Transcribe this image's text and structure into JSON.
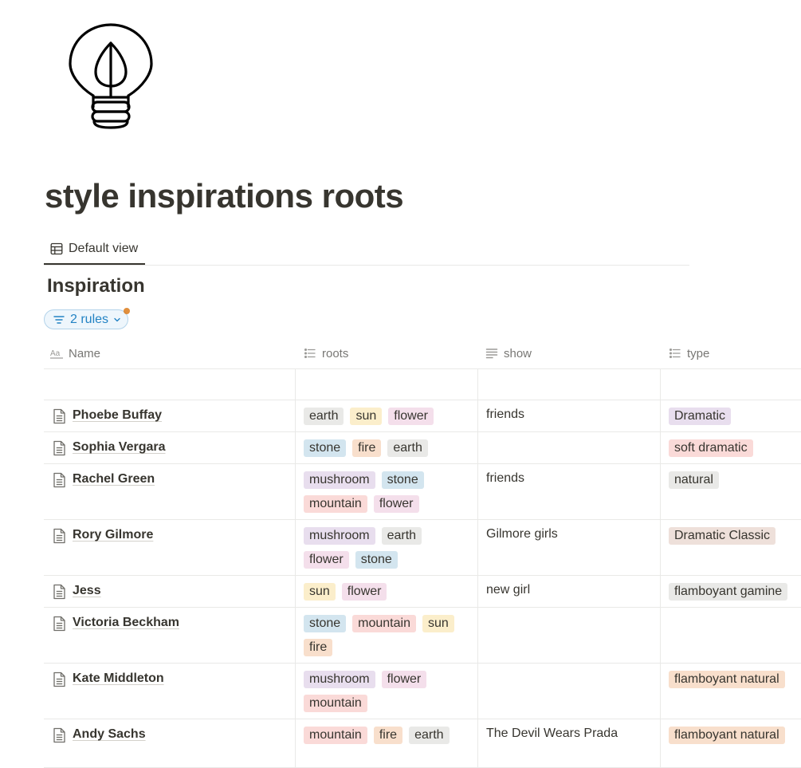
{
  "page": {
    "title": "style inspirations roots"
  },
  "view": {
    "tab_label": "Default view"
  },
  "database": {
    "title": "Inspiration",
    "rules_label": "2 rules"
  },
  "columns": [
    {
      "label": "Name",
      "icon": "text-aa-icon"
    },
    {
      "label": "roots",
      "icon": "multi-select-list-icon"
    },
    {
      "label": "show",
      "icon": "text-lines-icon"
    },
    {
      "label": "type",
      "icon": "multi-select-list-icon"
    }
  ],
  "tag_colors": {
    "gray": "#e9e9e7",
    "yellow": "#fbeecb",
    "pink": "#f4dfeb",
    "blue": "#d3e5ef",
    "orange": "#f8dfcc",
    "purple": "#e8deee",
    "red": "#fadad8",
    "brown": "#eee0da"
  },
  "rows": [
    {
      "name": "Phoebe Buffay",
      "roots": [
        {
          "label": "earth",
          "color": "gray"
        },
        {
          "label": "sun",
          "color": "yellow"
        },
        {
          "label": "flower",
          "color": "pink"
        }
      ],
      "show": "friends",
      "type": [
        {
          "label": "Dramatic",
          "color": "purple"
        }
      ]
    },
    {
      "name": "Sophia Vergara",
      "roots": [
        {
          "label": "stone",
          "color": "blue"
        },
        {
          "label": "fire",
          "color": "orange"
        },
        {
          "label": "earth",
          "color": "gray"
        }
      ],
      "show": "",
      "type": [
        {
          "label": "soft dramatic",
          "color": "red"
        }
      ]
    },
    {
      "name": "Rachel Green",
      "roots": [
        {
          "label": "mushroom",
          "color": "purple"
        },
        {
          "label": "stone",
          "color": "blue"
        },
        {
          "label": "mountain",
          "color": "red"
        },
        {
          "label": "flower",
          "color": "pink"
        }
      ],
      "show": "friends",
      "type": [
        {
          "label": "natural",
          "color": "gray"
        }
      ]
    },
    {
      "name": "Rory Gilmore",
      "roots": [
        {
          "label": "mushroom",
          "color": "purple"
        },
        {
          "label": "earth",
          "color": "gray"
        },
        {
          "label": "flower",
          "color": "pink"
        },
        {
          "label": "stone",
          "color": "blue"
        }
      ],
      "show": "Gilmore girls",
      "type": [
        {
          "label": "Dramatic Classic",
          "color": "brown"
        }
      ]
    },
    {
      "name": "Jess",
      "roots": [
        {
          "label": "sun",
          "color": "yellow"
        },
        {
          "label": "flower",
          "color": "pink"
        }
      ],
      "show": "new girl",
      "type": [
        {
          "label": "flamboyant gamine",
          "color": "gray"
        }
      ]
    },
    {
      "name": "Victoria Beckham",
      "roots": [
        {
          "label": "stone",
          "color": "blue"
        },
        {
          "label": "mountain",
          "color": "red"
        },
        {
          "label": "sun",
          "color": "yellow"
        },
        {
          "label": "fire",
          "color": "orange"
        }
      ],
      "show": "",
      "type": []
    },
    {
      "name": "Kate Middleton",
      "roots": [
        {
          "label": "mushroom",
          "color": "purple"
        },
        {
          "label": "flower",
          "color": "pink"
        },
        {
          "label": "mountain",
          "color": "red"
        }
      ],
      "show": "",
      "type": [
        {
          "label": "flamboyant natural",
          "color": "orange"
        }
      ]
    },
    {
      "name": "Andy Sachs",
      "roots": [
        {
          "label": "mountain",
          "color": "red"
        },
        {
          "label": "fire",
          "color": "orange"
        },
        {
          "label": "earth",
          "color": "gray"
        }
      ],
      "show": "The Devil Wears Prada",
      "type": [
        {
          "label": "flamboyant natural",
          "color": "orange"
        }
      ]
    }
  ]
}
